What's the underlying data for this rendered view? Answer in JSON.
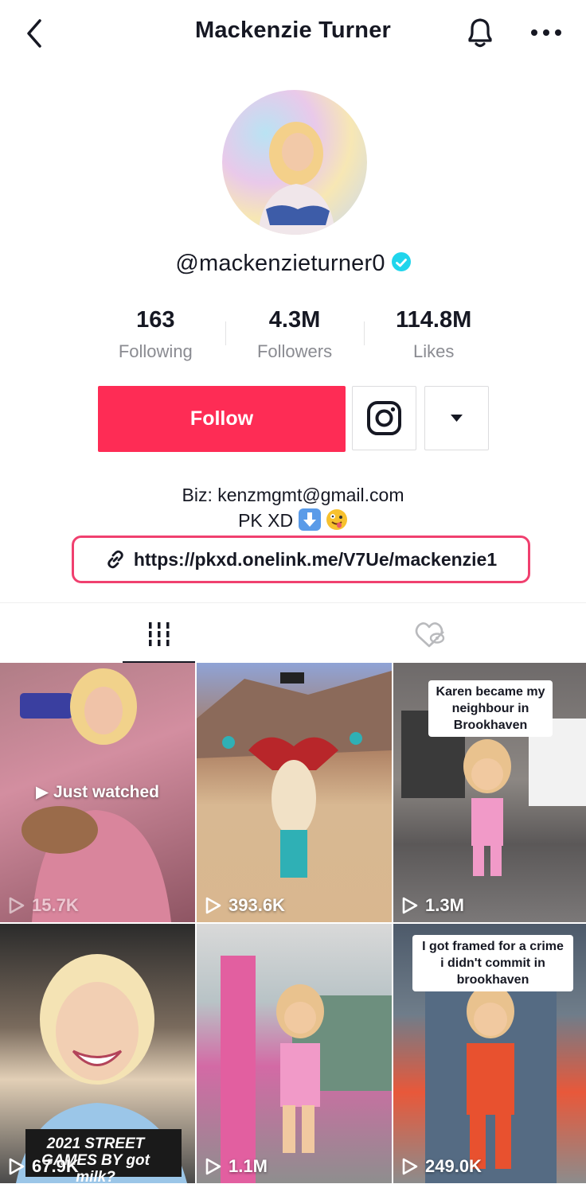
{
  "header": {
    "title": "Mackenzie Turner"
  },
  "profile": {
    "handle": "@mackenzieturner0",
    "stats": [
      {
        "value": "163",
        "label": "Following"
      },
      {
        "value": "4.3M",
        "label": "Followers"
      },
      {
        "value": "114.8M",
        "label": "Likes"
      }
    ],
    "follow_label": "Follow",
    "bio_line1": "Biz: kenzmgmt@gmail.com",
    "bio_line2": "PK XD",
    "link": "https://pkxd.onelink.me/V7Ue/mackenzie1"
  },
  "colors": {
    "accent": "#fe2c55",
    "verified": "#20d5ec",
    "link_border": "#f0406f"
  },
  "icons": {
    "back": "chevron-left-icon",
    "notifications": "bell-icon",
    "more": "more-horizontal-icon",
    "instagram": "instagram-icon",
    "dropdown": "triangle-down-icon",
    "link": "link-icon",
    "videos_tab": "grid-icon",
    "liked_tab": "hidden-heart-icon"
  },
  "videos": [
    {
      "views": "15.7K",
      "overlay": "Just watched"
    },
    {
      "views": "393.6K"
    },
    {
      "views": "1.3M",
      "caption": "Karen became my neighbour in Brookhaven"
    },
    {
      "views": "67.9K",
      "caption": "2021 STREET GAMES BY got milk?"
    },
    {
      "views": "1.1M"
    },
    {
      "views": "249.0K",
      "caption": "I got framed for a crime i didn't commit in brookhaven"
    }
  ]
}
